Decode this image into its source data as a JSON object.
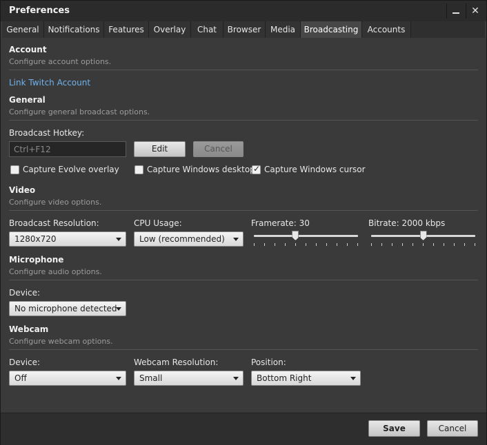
{
  "window": {
    "title": "Preferences"
  },
  "tabs": [
    {
      "label": "General"
    },
    {
      "label": "Notifications"
    },
    {
      "label": "Features"
    },
    {
      "label": "Overlay"
    },
    {
      "label": "Chat"
    },
    {
      "label": "Browser"
    },
    {
      "label": "Media"
    },
    {
      "label": "Broadcasting"
    },
    {
      "label": "Accounts"
    }
  ],
  "active_tab": "Broadcasting",
  "account": {
    "title": "Account",
    "subtitle": "Configure account options.",
    "link": "Link Twitch Account"
  },
  "general": {
    "title": "General",
    "subtitle": "Configure general broadcast options.",
    "hotkey_label": "Broadcast Hotkey:",
    "hotkey_value": "Ctrl+F12",
    "edit_label": "Edit",
    "cancel_label": "Cancel",
    "capture_overlay": {
      "label": "Capture Evolve overlay",
      "checked": false
    },
    "capture_desktop": {
      "label": "Capture Windows desktop",
      "checked": false
    },
    "capture_cursor": {
      "label": "Capture Windows cursor",
      "checked": true
    }
  },
  "video": {
    "title": "Video",
    "subtitle": "Configure video options.",
    "resolution_label": "Broadcast Resolution:",
    "resolution_value": "1280x720",
    "cpu_label": "CPU Usage:",
    "cpu_value": "Low (recommended)",
    "framerate_label": "Framerate: 30",
    "framerate_fraction": 0.4,
    "bitrate_label": "Bitrate: 2000 kbps",
    "bitrate_fraction": 0.5
  },
  "microphone": {
    "title": "Microphone",
    "subtitle": "Configure audio options.",
    "device_label": "Device:",
    "device_value": "No microphone detected"
  },
  "webcam": {
    "title": "Webcam",
    "subtitle": "Configure webcam options.",
    "device_label": "Device:",
    "device_value": "Off",
    "resolution_label": "Webcam Resolution:",
    "resolution_value": "Small",
    "position_label": "Position:",
    "position_value": "Bottom Right"
  },
  "footer": {
    "save_label": "Save",
    "cancel_label": "Cancel"
  }
}
